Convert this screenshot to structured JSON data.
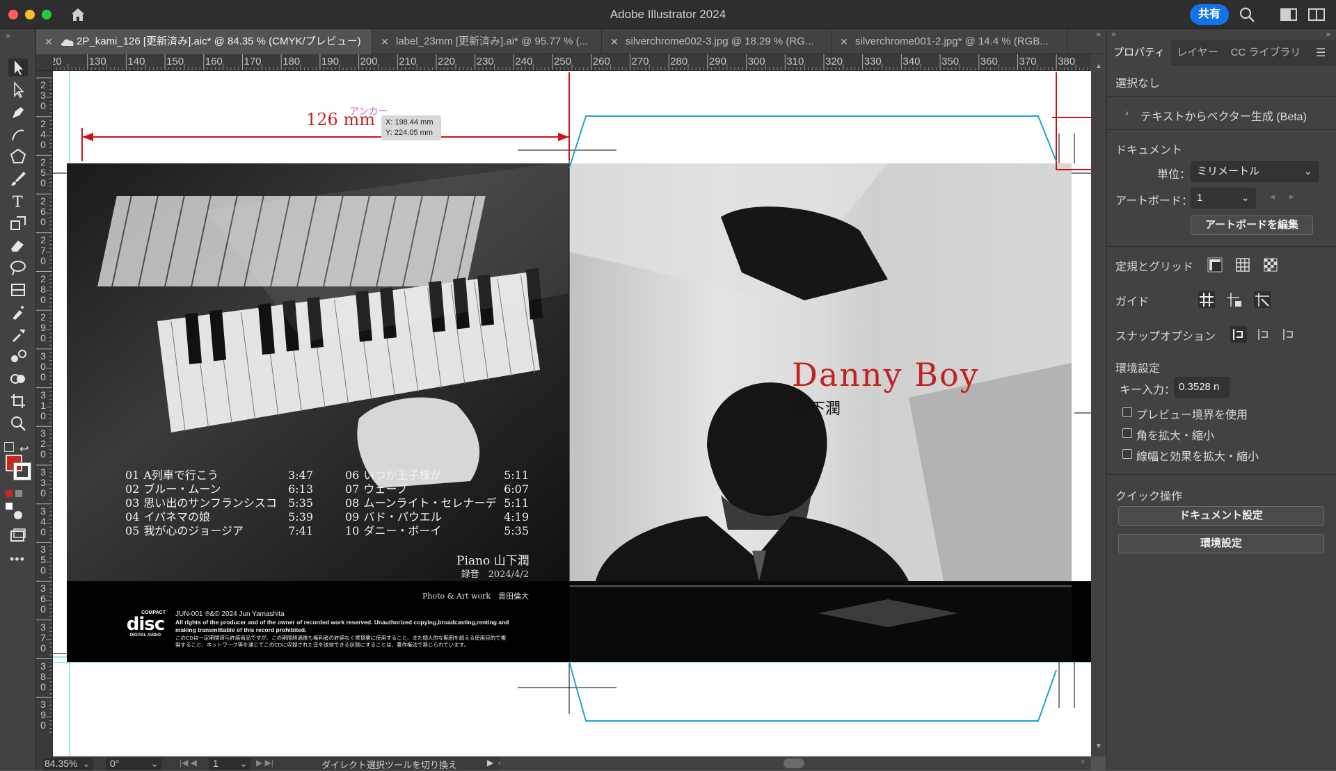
{
  "app": {
    "title": "Adobe Illustrator 2024",
    "share_label": "共有"
  },
  "tabs": [
    {
      "label": "2P_kami_126 [更新済み].aic* @ 84.35 % (CMYK/プレビュー)"
    },
    {
      "label": "label_23mm [更新済み].ai* @ 95.77 % (..."
    },
    {
      "label": "silverchrome002-3.jpg @ 18.29 % (RG..."
    },
    {
      "label": "silverchrome001-2.jpg* @ 14.4 % (RGB..."
    }
  ],
  "ruler": {
    "top_labels": [
      "20",
      "130",
      "140",
      "150",
      "160",
      "170",
      "180",
      "190",
      "200",
      "210",
      "220",
      "230",
      "240",
      "250",
      "260",
      "270",
      "280",
      "290",
      "300",
      "310",
      "320",
      "330",
      "340",
      "350",
      "360",
      "370",
      "380"
    ],
    "left_labels": [
      "230",
      "240",
      "250",
      "260",
      "270",
      "280",
      "290",
      "300",
      "310",
      "320",
      "330",
      "340",
      "350",
      "360",
      "370",
      "380",
      "390"
    ]
  },
  "measure": {
    "width_label": "126 mm",
    "anchor_label": "アンカー",
    "x_readout": "X: 198.44 mm",
    "y_readout": "Y: 224.05 mm"
  },
  "album": {
    "title": "Danny Boy",
    "artist": "山下潤",
    "tracks_left": [
      {
        "no": "01",
        "name": "A列車で行こう",
        "time": "3:47"
      },
      {
        "no": "02",
        "name": "ブルー・ムーン",
        "time": "6:13"
      },
      {
        "no": "03",
        "name": "思い出のサンフランシスコ",
        "time": "5:35"
      },
      {
        "no": "04",
        "name": "イパネマの娘",
        "time": "5:39"
      },
      {
        "no": "05",
        "name": "我が心のジョージア",
        "time": "7:41"
      }
    ],
    "tracks_right": [
      {
        "no": "06",
        "name": "いつか王子様が",
        "time": "5:11"
      },
      {
        "no": "07",
        "name": "ウェーブ",
        "time": "6:07"
      },
      {
        "no": "08",
        "name": "ムーンライト・セレナーデ",
        "time": "5:11"
      },
      {
        "no": "09",
        "name": "バド・パウエル",
        "time": "4:19"
      },
      {
        "no": "10",
        "name": "ダニー・ボーイ",
        "time": "5:35"
      }
    ],
    "piano_credit": "Piano 山下潤",
    "recording": "録音　2024/4/2",
    "photo_credit": "Photo & Art work　貴田倫大",
    "catalog": "JUN-001 ℗&© 2024 Jun Yamashita",
    "rights_en": "All rights of the producer and of the owner of recorded work reserved. Unauthorized copying,broadcasting,renting and making transmittable of this record prohibited.",
    "rights_jp": "このCDは一定期間貸与許諾商品ですが、この期間経過後も権利者の許諾なく賃貸業に使用すること、また個人的な範囲を超える使用目的で複製すること、ネットワーク等を通じてこのCDに収録された音を送信できる状態にすることは、著作権法で禁じられています。",
    "cd_logo_top": "COMPACT",
    "cd_logo_mid": "disc",
    "cd_logo_bottom": "DIGITAL AUDIO",
    "title_color": "#c0221f"
  },
  "panel": {
    "tabs": [
      "プロパティ",
      "レイヤー",
      "CC ライブラリ"
    ],
    "no_selection": "選択なし",
    "text_to_vector": "テキストからベクター生成 (Beta)",
    "document_heading": "ドキュメント",
    "unit_label": "単位：",
    "unit_value": "ミリメートル",
    "artboard_label": "アートボード：",
    "artboard_value": "1",
    "edit_artboard": "アートボードを編集",
    "rulers_grids": "定規とグリッド",
    "guides": "ガイド",
    "snap_options": "スナップオプション",
    "preferences_heading": "環境設定",
    "key_input_label": "キー入力：",
    "key_input_value": "0.3528 n",
    "preview_bounds": "プレビュー境界を使用",
    "scale_corners": "角を拡大・縮小",
    "scale_strokes": "線幅と効果を拡大・縮小",
    "quick_actions": "クイック操作",
    "document_setup": "ドキュメント設定",
    "preferences_btn": "環境設定"
  },
  "status": {
    "zoom": "84.35%",
    "rotation": "0°",
    "artboard": "1",
    "tool_hint": "ダイレクト選択ツールを切り換え"
  }
}
